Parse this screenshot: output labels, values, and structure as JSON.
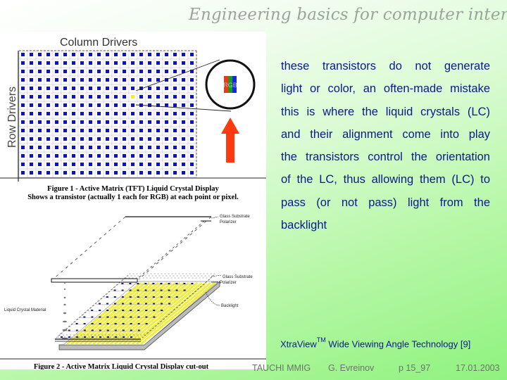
{
  "slide": {
    "title": "Engineering basics for computer interaction",
    "bullets": [
      "these transistors do not generate",
      "light or color, an often-made mistake",
      "this is where the liquid crystals (LC)",
      "and their alignment come into play",
      "the transistors control the orientation",
      "of the LC, thus allowing them (LC) to",
      "pass (or not pass) light from the",
      "backlight"
    ],
    "xtraview": {
      "name": "XtraView",
      "trademark": "TM",
      "rest": " Wide Viewing Angle Technology [9]"
    }
  },
  "figure1": {
    "column_label": "Column Drivers",
    "row_label": "Row Drivers",
    "rgb_label": "RGB",
    "grid_columns": 21,
    "grid_rows": 15,
    "highlight_cell": {
      "row": 5,
      "col": 13
    },
    "colors": {
      "dot": "#1010c8",
      "grid": "#c8cce8",
      "highlight": "#f2f21a",
      "arrow": "#ff3a10",
      "r": "#e83a1a",
      "g": "#1a9a2a",
      "b": "#1428e0"
    },
    "caption_line1": "Figure 1 - Active Matrix (TFT) Liquid Crystal Display",
    "caption_line2": "Shows a transistor (actually 1 each for RGB) at each point or pixel."
  },
  "figure2": {
    "labels": {
      "glass_substrate_top": "Glass Substrate",
      "polarizer": "Polarizer",
      "glass_substrate_bottom": "Glass Substrate",
      "polarizer_bottom": "Polarizer",
      "liquid_crystal": "Liquid Crystal Material",
      "backlight": "Backlight"
    },
    "caption": "Figure 2 - Active Matrix Liquid Crystal Display cut-out"
  },
  "footer": {
    "org": "TAUCHI MMIG",
    "author": "G. Evreinov",
    "page": "p 15_97",
    "date": "17.01.2003"
  }
}
